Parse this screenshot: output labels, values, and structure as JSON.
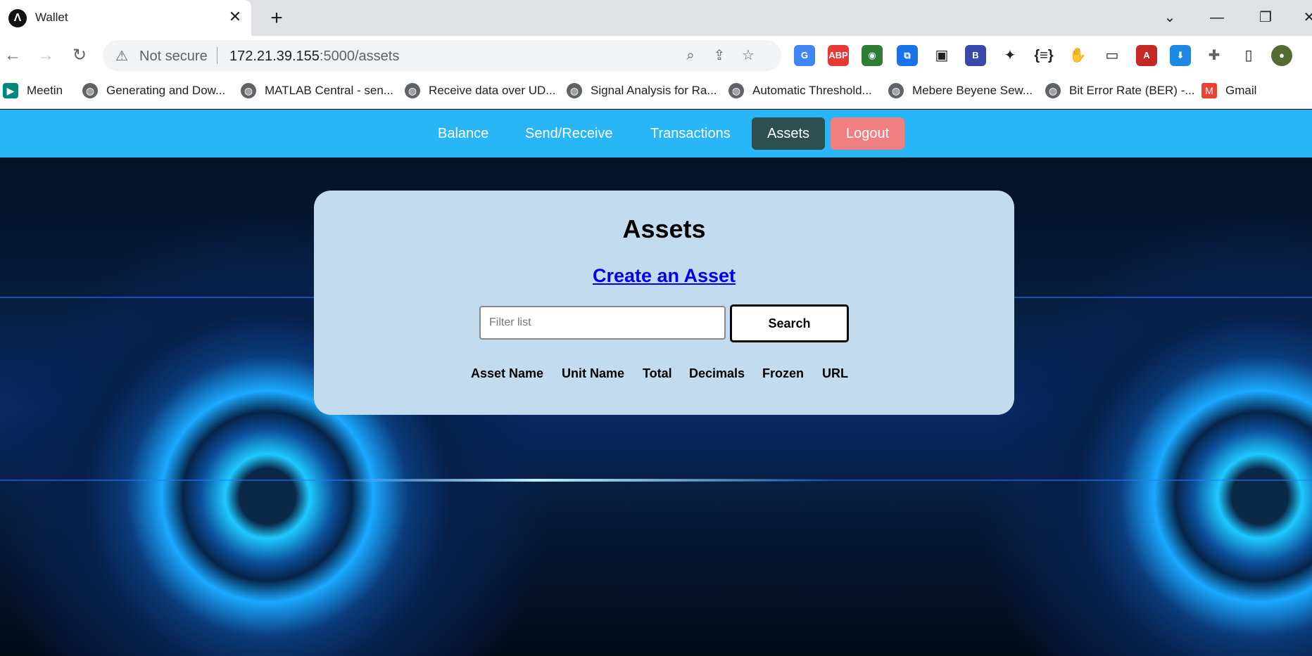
{
  "browser": {
    "tab_title": "Wallet",
    "tab_close": "✕",
    "new_tab": "+",
    "window_controls": {
      "tab_search": "⌄",
      "minimize": "—",
      "restore": "❐",
      "close": "✕"
    },
    "nav": {
      "back": "←",
      "forward": "→",
      "reload": "↻"
    },
    "address": {
      "security_label": "Not secure",
      "warning_icon": "⚠",
      "host": "172.21.39.155",
      "path": ":5000/assets"
    },
    "address_icons": {
      "zoom": "⌕",
      "share": "⇪",
      "bookmark": "☆"
    },
    "extensions": [
      {
        "name": "google-translate-icon",
        "glyph": "G",
        "color": "#4285f4"
      },
      {
        "name": "adblock-plus-icon",
        "glyph": "ABP",
        "color": "#e53935"
      },
      {
        "name": "download-manager-icon",
        "glyph": "◉",
        "color": "#2e7d32"
      },
      {
        "name": "copy-icon",
        "glyph": "⧉",
        "color": "#1a73e8"
      },
      {
        "name": "tab-copy-icon",
        "glyph": "▣",
        "color": "#202124"
      },
      {
        "name": "b-extension-icon",
        "glyph": "B",
        "color": "#3949ab"
      },
      {
        "name": "fox-extension-icon",
        "glyph": "✦",
        "color": "#202124"
      },
      {
        "name": "json-formatter-icon",
        "glyph": "{≡}",
        "color": "#202124"
      },
      {
        "name": "hand-icon",
        "glyph": "✋",
        "color": "#202124"
      },
      {
        "name": "picture-in-picture-icon",
        "glyph": "▭",
        "color": "#202124"
      },
      {
        "name": "algorand-icon",
        "glyph": "A",
        "color": "#c62828"
      },
      {
        "name": "download-icon",
        "glyph": "⬇",
        "color": "#1e88e5"
      },
      {
        "name": "extensions-puzzle-icon",
        "glyph": "✚",
        "color": "#5f6368"
      },
      {
        "name": "side-panel-icon",
        "glyph": "▯",
        "color": "#202124"
      },
      {
        "name": "profile-avatar-icon",
        "glyph": "●",
        "color": "#556b2f"
      }
    ],
    "bookmarks": [
      {
        "label": "Meetin",
        "icon": "meet-icon"
      },
      {
        "label": "Generating and Dow...",
        "icon": "globe-icon"
      },
      {
        "label": "MATLAB Central - sen...",
        "icon": "globe-icon"
      },
      {
        "label": "Receive data over UD...",
        "icon": "globe-icon"
      },
      {
        "label": "Signal Analysis for Ra...",
        "icon": "globe-icon"
      },
      {
        "label": "Automatic Threshold...",
        "icon": "globe-icon"
      },
      {
        "label": "Mebere Beyene Sew...",
        "icon": "globe-icon"
      },
      {
        "label": "Bit Error Rate (BER) -...",
        "icon": "globe-icon"
      },
      {
        "label": "Gmail",
        "icon": "gmail-icon"
      }
    ]
  },
  "navbar": {
    "items": [
      {
        "label": "Balance"
      },
      {
        "label": "Send/Receive"
      },
      {
        "label": "Transactions"
      },
      {
        "label": "Assets",
        "active": true
      },
      {
        "label": "Logout"
      }
    ],
    "colors": {
      "bar": "#29b6f6",
      "active": "#2f4f4f",
      "logout": "#f08080"
    }
  },
  "assets_card": {
    "title": "Assets",
    "create_link": "Create an Asset",
    "filter": {
      "placeholder": "Filter list",
      "value": ""
    },
    "search_button": "Search",
    "columns": [
      "Asset Name",
      "Unit Name",
      "Total",
      "Decimals",
      "Frozen",
      "URL"
    ],
    "rows": []
  }
}
